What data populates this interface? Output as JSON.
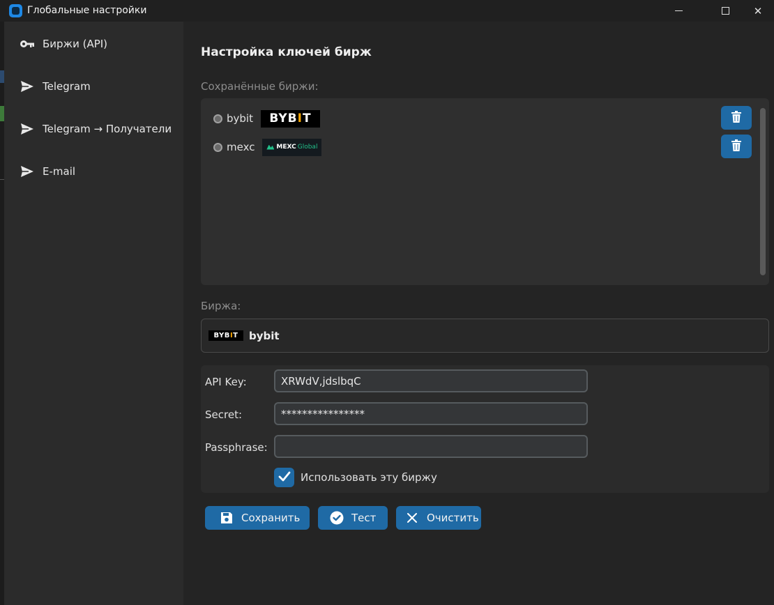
{
  "window": {
    "title": "Глобальные настройки",
    "minimize_glyph": "",
    "close_glyph": "✕"
  },
  "sidebar": {
    "items": [
      {
        "label": "Биржи (API)",
        "icon": "key-icon"
      },
      {
        "label": "Telegram",
        "icon": "send-icon"
      },
      {
        "label": "Telegram → Получатели",
        "icon": "send-icon"
      },
      {
        "label": "E-mail",
        "icon": "send-icon"
      }
    ]
  },
  "main": {
    "title": "Настройка ключей бирж",
    "saved_label": "Сохранённые биржи:",
    "saved_exchanges": [
      {
        "name": "bybit",
        "logo_text": "BYB",
        "logo_accent": "I",
        "logo_tail": "T"
      },
      {
        "name": "mexc",
        "logo_text": "MEXC",
        "logo_sub": "Global"
      }
    ],
    "exchange_label": "Биржа:",
    "selected_exchange": {
      "name": "bybit",
      "logo_text": "BYB",
      "logo_accent": "I",
      "logo_tail": "T"
    },
    "form": {
      "api_key_label": "API Key:",
      "api_key_value": "XRWd\u0007V,j\u0001dslbqC",
      "secret_label": "Secret:",
      "secret_value": "****************",
      "passphrase_label": "Passphrase:",
      "passphrase_value": "",
      "use_exchange_label": "Использовать эту биржу",
      "use_exchange_checked": true
    },
    "buttons": {
      "save": "Сохранить",
      "test": "Тест",
      "clear": "Очистить"
    }
  },
  "colors": {
    "accent": "#1f6aa5",
    "bybit_accent": "#f7a600",
    "mexc_accent": "#22c08a"
  }
}
